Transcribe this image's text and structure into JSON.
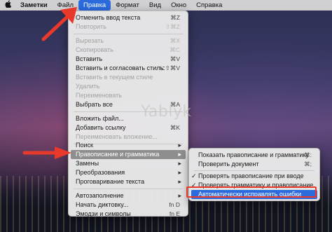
{
  "menubar": {
    "apple_icon": "",
    "items": [
      "Заметки",
      "Файл",
      "Правка",
      "Формат",
      "Вид",
      "Окно",
      "Справка"
    ]
  },
  "edit_menu": {
    "items": [
      {
        "label": "Отменить ввод текста",
        "shortcut": "⌘Z",
        "enabled": true
      },
      {
        "label": "Повторить",
        "shortcut": "⇧⌘Z",
        "enabled": false
      },
      {
        "label": "Вырезать",
        "shortcut": "⌘X",
        "enabled": false
      },
      {
        "label": "Скопировать",
        "shortcut": "⌘C",
        "enabled": false
      },
      {
        "label": "Вставить",
        "shortcut": "⌘V",
        "enabled": true
      },
      {
        "label": "Вставить и согласовать стиль",
        "shortcut": "⌥⇧⌘V",
        "enabled": true
      },
      {
        "label": "Вставить в текущем стиле",
        "shortcut": "",
        "enabled": false
      },
      {
        "label": "Удалить",
        "shortcut": "",
        "enabled": false
      },
      {
        "label": "Переименовать",
        "shortcut": "",
        "enabled": false
      },
      {
        "label": "Выбрать все",
        "shortcut": "⌘A",
        "enabled": true
      },
      {
        "label": "Вложить файл...",
        "shortcut": "",
        "enabled": true
      },
      {
        "label": "Добавить ссылку",
        "shortcut": "⌘K",
        "enabled": true
      },
      {
        "label": "Переименовать вложение...",
        "shortcut": "",
        "enabled": false
      },
      {
        "label": "Поиск",
        "shortcut": "",
        "enabled": true,
        "submenu": true
      },
      {
        "label": "Правописание и грамматика",
        "shortcut": "",
        "enabled": true,
        "submenu": true,
        "highlighted": true
      },
      {
        "label": "Замены",
        "shortcut": "",
        "enabled": true,
        "submenu": true
      },
      {
        "label": "Преобразования",
        "shortcut": "",
        "enabled": true,
        "submenu": true
      },
      {
        "label": "Проговаривание текста",
        "shortcut": "",
        "enabled": true,
        "submenu": true
      },
      {
        "label": "Автозаполнение",
        "shortcut": "",
        "enabled": true,
        "submenu": true
      },
      {
        "label": "Начать диктовку...",
        "shortcut": "fn D",
        "enabled": true
      },
      {
        "label": "Эмодзи и символы",
        "shortcut": "fn E",
        "enabled": true
      }
    ]
  },
  "spelling_submenu": {
    "items": [
      {
        "label": "Показать правописание и грамматику",
        "shortcut": "⌘:",
        "checked": false
      },
      {
        "label": "Проверить документ",
        "shortcut": "⌘;",
        "checked": false
      },
      {
        "label": "Проверять правописание при вводе",
        "shortcut": "",
        "checked": true
      },
      {
        "label": "Проверять грамматику и правописание",
        "shortcut": "",
        "checked": true
      },
      {
        "label": "Автоматически исправлять ошибки",
        "shortcut": "",
        "checked": false,
        "selected": true
      }
    ],
    "check_mark": "✓"
  },
  "watermark": "Yablyk",
  "colors": {
    "selection_blue": "#2b6bde",
    "highlight_gray": "#8e8e8e",
    "annotation_red": "#e8392a"
  }
}
